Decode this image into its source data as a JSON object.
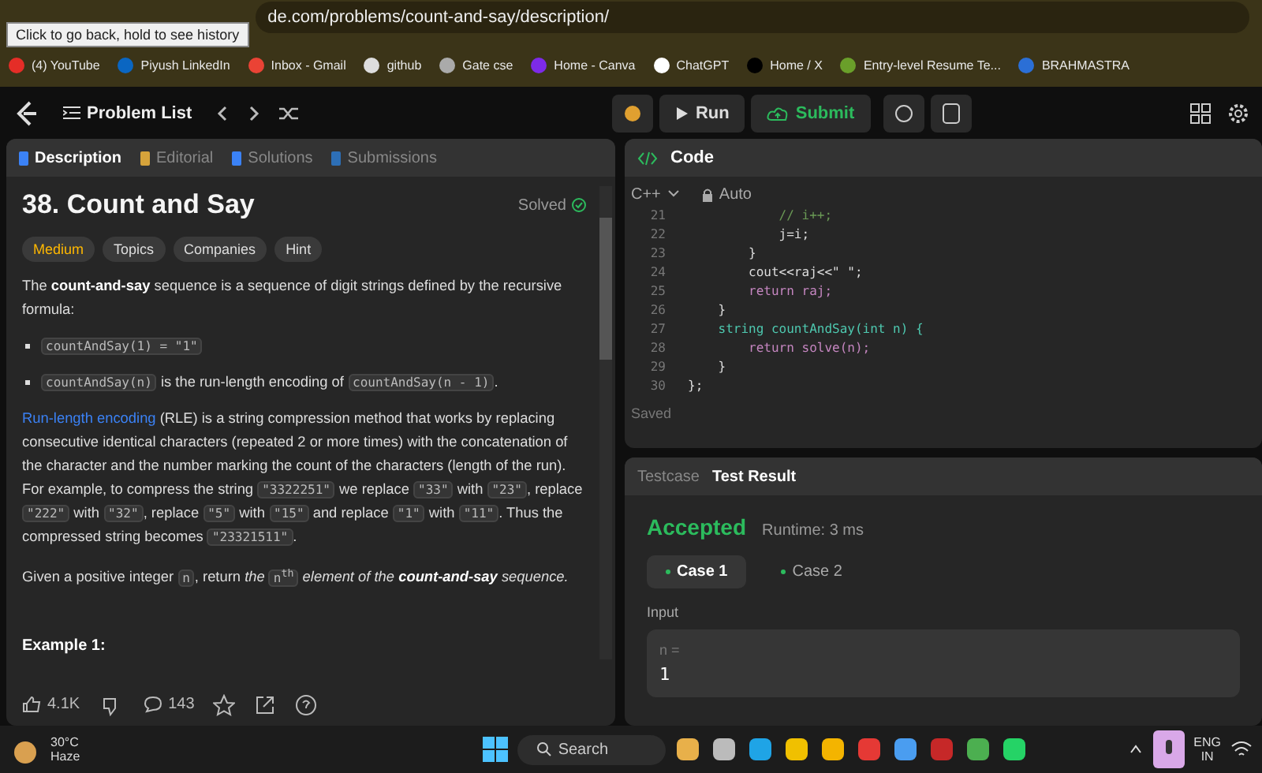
{
  "browser": {
    "url": "de.com/problems/count-and-say/description/",
    "tooltip": "Click to go back, hold to see history",
    "bookmarks": [
      "(4) YouTube",
      "Piyush LinkedIn",
      "Inbox - Gmail",
      "github",
      "Gate cse",
      "Home - Canva",
      "ChatGPT",
      "Home / X",
      "Entry-level Resume Te...",
      "BRAHMASTRA"
    ]
  },
  "toolbar": {
    "problem_list": "Problem List",
    "run": "Run",
    "submit": "Submit"
  },
  "left_panel": {
    "tabs": [
      {
        "label": "Description",
        "selected": true
      },
      {
        "label": "Editorial",
        "selected": false
      },
      {
        "label": "Solutions",
        "selected": false
      },
      {
        "label": "Submissions",
        "selected": false
      }
    ],
    "title": "38. Count and Say",
    "status": "Solved",
    "difficulty": "Medium",
    "chips": [
      "Topics",
      "Companies",
      "Hint"
    ],
    "paragraphs": [
      [
        {
          "kind": "text",
          "text": "The "
        },
        {
          "kind": "bold",
          "text": "count-and-say"
        },
        {
          "kind": "text",
          "text": " sequence is a sequence of digit strings defined by the recursive formula:"
        }
      ],
      [
        {
          "kind": "code",
          "text": "countAndSay(1) = \"1\""
        }
      ],
      [
        {
          "kind": "code",
          "text": "countAndSay(n)"
        },
        {
          "kind": "text",
          "text": " is the run-length encoding of "
        },
        {
          "kind": "code",
          "text": "countAndSay(n - 1)"
        },
        {
          "kind": "text",
          "text": "."
        }
      ],
      [
        {
          "kind": "link",
          "text": "Run-length encoding"
        },
        {
          "kind": "text",
          "text": " (RLE) is a string compression method that works by replacing consecutive identical characters (repeated 2 or more times) with the concatenation of the character and the number marking the count of the characters (length of the run). For example, to compress the string "
        },
        {
          "kind": "code",
          "text": "\"3322251\""
        },
        {
          "kind": "text",
          "text": " we replace "
        },
        {
          "kind": "code",
          "text": "\"33\""
        },
        {
          "kind": "text",
          "text": " with "
        },
        {
          "kind": "code",
          "text": "\"23\""
        },
        {
          "kind": "text",
          "text": ", replace "
        },
        {
          "kind": "code",
          "text": "\"222\""
        },
        {
          "kind": "text",
          "text": " with "
        },
        {
          "kind": "code",
          "text": "\"32\""
        },
        {
          "kind": "text",
          "text": ", replace "
        },
        {
          "kind": "code",
          "text": "\"5\""
        },
        {
          "kind": "text",
          "text": " with "
        },
        {
          "kind": "code",
          "text": "\"15\""
        },
        {
          "kind": "text",
          "text": " and replace "
        },
        {
          "kind": "code",
          "text": "\"1\""
        },
        {
          "kind": "text",
          "text": " with "
        },
        {
          "kind": "code",
          "text": "\"11\""
        },
        {
          "kind": "text",
          "text": ". Thus the compressed string becomes "
        },
        {
          "kind": "code",
          "text": "\"23321511\""
        },
        {
          "kind": "text",
          "text": "."
        }
      ],
      [
        {
          "kind": "text",
          "text": "Given a positive integer "
        },
        {
          "kind": "code",
          "text": "n"
        },
        {
          "kind": "text",
          "text": ", return "
        },
        {
          "kind": "italic",
          "text": "the "
        },
        {
          "kind": "code",
          "text": "n$^{th}$"
        },
        {
          "kind": "italic",
          "text": " element of the "
        },
        {
          "kind": "bolditalic",
          "text": "count-and-say"
        },
        {
          "kind": "italic",
          "text": " sequence."
        }
      ]
    ],
    "bullets": [
      false,
      true,
      true,
      false,
      false
    ],
    "example_heading": "Example 1:",
    "likes": "4.1K",
    "comments": "143"
  },
  "code_panel": {
    "title": "Code",
    "language": "C++",
    "mode": "Auto",
    "status": "Saved",
    "lines": [
      {
        "number": "21",
        "code": "            // i++;",
        "kind": "comment"
      },
      {
        "number": "22",
        "code": "            j=i;",
        "kind": "plain"
      },
      {
        "number": "23",
        "code": "        }",
        "kind": "plain"
      },
      {
        "number": "24",
        "code": "        cout<<raj<<\" \";",
        "kind": "plain"
      },
      {
        "number": "25",
        "code": "        return raj;",
        "kind": "keyword"
      },
      {
        "number": "26",
        "code": "    }",
        "kind": "plain"
      },
      {
        "number": "27",
        "code": "    string countAndSay(int n) {",
        "kind": "declaration"
      },
      {
        "number": "28",
        "code": "        return solve(n);",
        "kind": "keyword"
      },
      {
        "number": "29",
        "code": "    }",
        "kind": "plain"
      },
      {
        "number": "30",
        "code": "};",
        "kind": "plain"
      }
    ]
  },
  "result_panel": {
    "tabs": [
      {
        "label": "Testcase",
        "selected": false
      },
      {
        "label": "Test Result",
        "selected": true
      }
    ],
    "verdict": "Accepted",
    "runtime": "Runtime: 3 ms",
    "cases": [
      {
        "label": "Case 1",
        "selected": true
      },
      {
        "label": "Case 2",
        "selected": false
      }
    ],
    "input_label": "Input",
    "input_name": "n =",
    "input_value": "1"
  },
  "taskbar": {
    "temperature": "30°C",
    "weather": "Haze",
    "search_placeholder": "Search",
    "language": "ENG",
    "region": "IN"
  }
}
